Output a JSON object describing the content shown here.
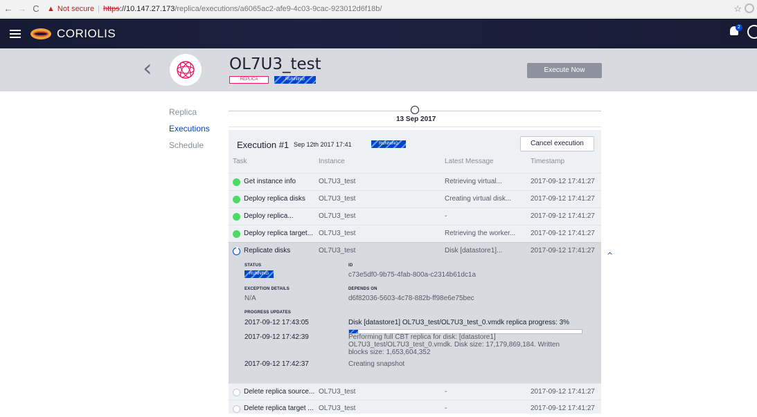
{
  "browser": {
    "back": "←",
    "forward": "→",
    "reload": "C",
    "warn_icon": "▲",
    "not_secure": "Not secure",
    "url_scheme": "https",
    "url_host": "://10.147.27.173",
    "url_path": "/replica/executions/a6065ac2-afe9-4c03-9cac-923012d6f18b/",
    "bookmark_icon": "star-icon"
  },
  "app": {
    "logo_text": "CORIOLIS",
    "notification_count": "2"
  },
  "replica": {
    "name": "OL7U3_test",
    "type_badge": "REPLICA",
    "status_badge": "RUNNING",
    "execute_now_label": "Execute Now",
    "back_glyph": "‹"
  },
  "sidenav": {
    "items": [
      {
        "label": "Replica",
        "active": false
      },
      {
        "label": "Executions",
        "active": true
      },
      {
        "label": "Schedule",
        "active": false
      }
    ]
  },
  "timeline": {
    "date": "13 Sep 2017"
  },
  "execution": {
    "title": "Execution #1",
    "date": "Sep 12th 2017 17:41",
    "status": "RUNNING",
    "cancel_label": "Cancel execution",
    "columns": [
      "Task",
      "Instance",
      "Latest Message",
      "Timestamp"
    ],
    "tasks": [
      {
        "task": "Get instance info",
        "instance": "OL7U3_test",
        "message": "Retrieving virtual...",
        "timestamp": "2017-09-12 17:41:27",
        "state": "done"
      },
      {
        "task": "Deploy replica disks",
        "instance": "OL7U3_test",
        "message": "Creating virtual disk...",
        "timestamp": "2017-09-12 17:41:27",
        "state": "done"
      },
      {
        "task": "Deploy replica...",
        "instance": "OL7U3_test",
        "message": "-",
        "timestamp": "2017-09-12 17:41:27",
        "state": "done"
      },
      {
        "task": "Deploy replica target...",
        "instance": "OL7U3_test",
        "message": "Retrieving the worker...",
        "timestamp": "2017-09-12 17:41:27",
        "state": "done"
      },
      {
        "task": "Replicate disks",
        "instance": "OL7U3_test",
        "message": "Disk [datastore1]...",
        "timestamp": "2017-09-12 17:41:27",
        "state": "running"
      }
    ],
    "details": {
      "status_label": "STATUS",
      "status_value": "RUNNING",
      "id_label": "ID",
      "id_value": "c73e5df0-9b75-4fab-800a-c2314b61dc1a",
      "exception_label": "EXCEPTION DETAILS",
      "exception_value": "N/A",
      "depends_label": "DEPENDS ON",
      "depends_value": "d6f82036-5603-4c78-882b-ff98e6e75bec",
      "progress_label": "PROGRESS UPDATES",
      "progress_fraction": 0.03,
      "updates": [
        {
          "time": "2017-09-12 17:43:05",
          "message": "Disk [datastore1] OL7U3_test/OL7U3_test_0.vmdk replica progress: 3%"
        },
        {
          "time": "2017-09-12 17:42:39",
          "message": "Performing full CBT replica for disk: [datastore1] OL7U3_test/OL7U3_test_0.vmdk. Disk size: 17,179,869,184. Written blocks size: 1,653,604,352"
        },
        {
          "time": "2017-09-12 17:42:37",
          "message": "Creating snapshot"
        }
      ]
    },
    "pending_tasks": [
      {
        "task": "Delete replica source...",
        "instance": "OL7U3_test",
        "message": "-",
        "timestamp": "2017-09-12 17:41:27",
        "state": "pending"
      },
      {
        "task": "Delete replica target ...",
        "instance": "OL7U3_test",
        "message": "-",
        "timestamp": "2017-09-12 17:41:27",
        "state": "pending"
      }
    ],
    "collapse_glyph": "^"
  }
}
